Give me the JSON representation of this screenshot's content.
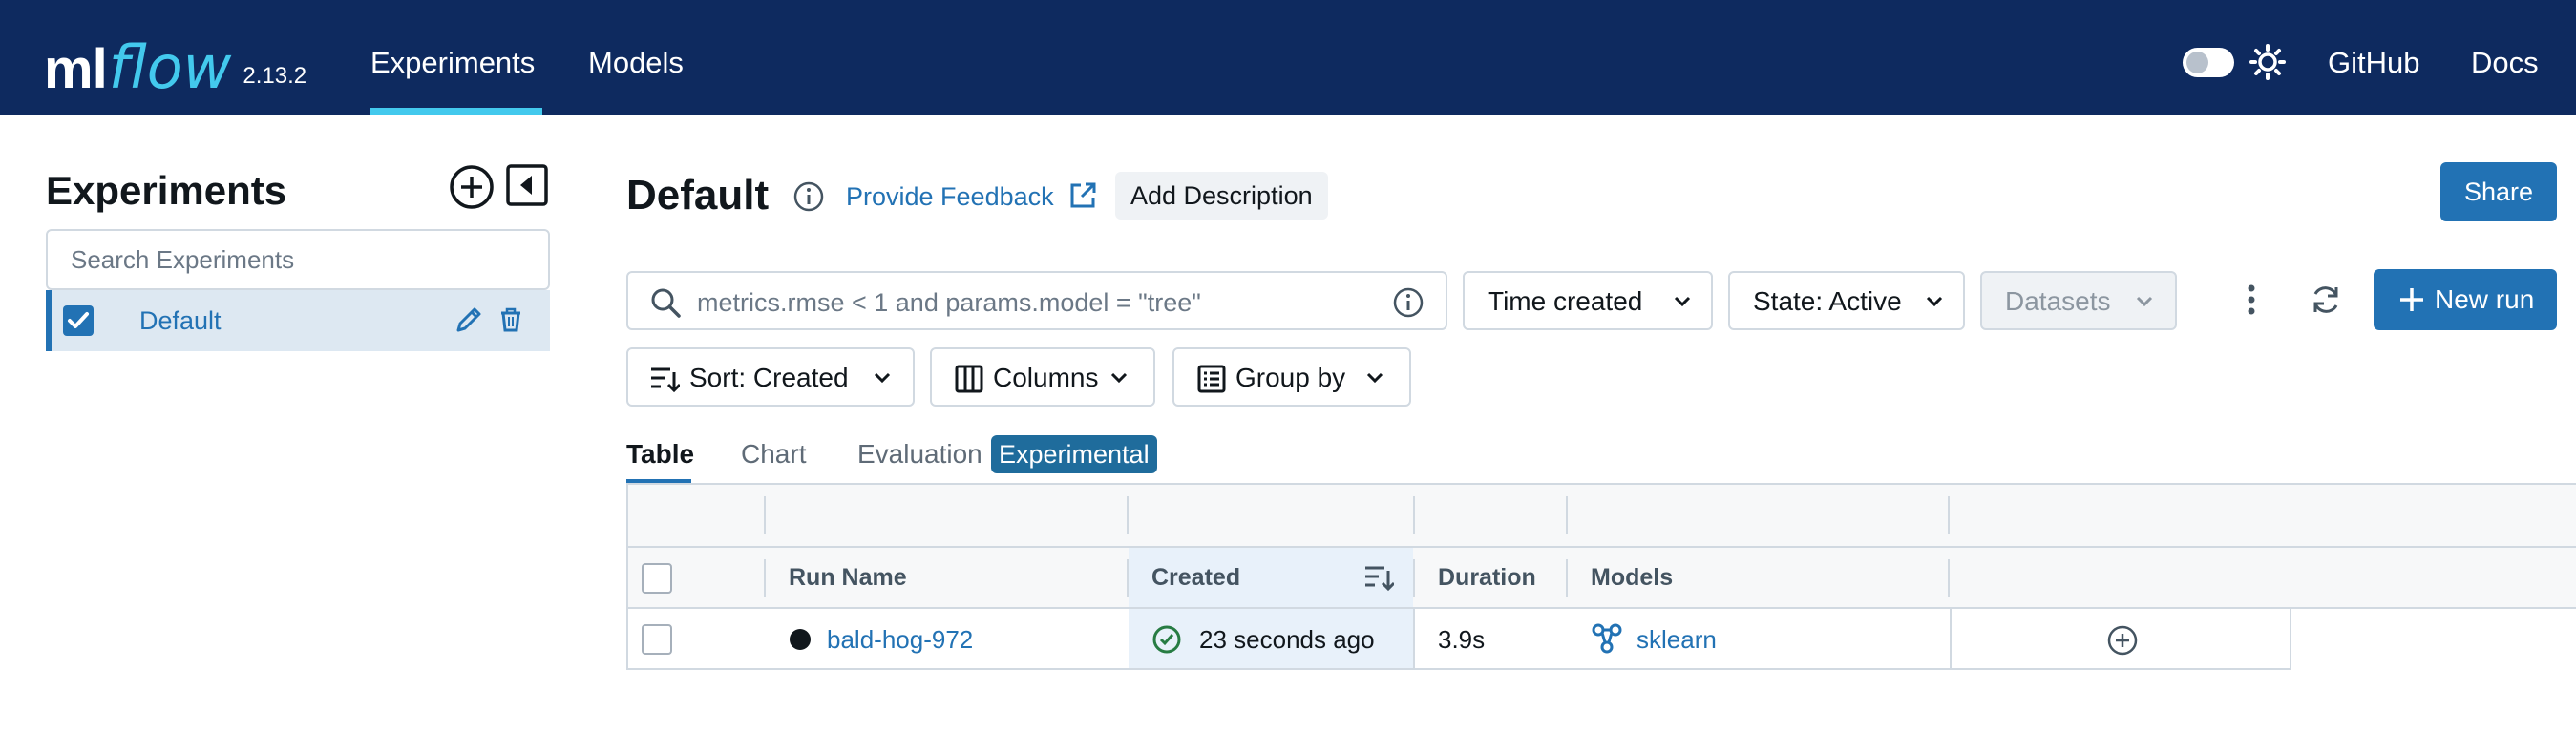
{
  "header": {
    "logo_main": "ml",
    "logo_accent": "flow",
    "version": "2.13.2",
    "nav": [
      {
        "label": "Experiments",
        "active": true
      },
      {
        "label": "Models",
        "active": false
      }
    ],
    "links": {
      "github": "GitHub",
      "docs": "Docs"
    },
    "theme_toggle_on": false
  },
  "sidebar": {
    "title": "Experiments",
    "search_placeholder": "Search Experiments",
    "experiments": [
      {
        "name": "Default",
        "selected": true
      }
    ]
  },
  "main": {
    "title": "Default",
    "feedback_label": "Provide Feedback",
    "add_description_label": "Add Description",
    "share_label": "Share",
    "search_placeholder": "metrics.rmse < 1 and params.model = \"tree\"",
    "filters": {
      "time_created": "Time created",
      "state": "State: Active",
      "datasets": "Datasets"
    },
    "new_run_label": "New run",
    "sort_label": "Sort: Created",
    "columns_label": "Columns",
    "group_by_label": "Group by",
    "tabs": [
      {
        "label": "Table",
        "active": true
      },
      {
        "label": "Chart",
        "active": false
      },
      {
        "label": "Evaluation",
        "active": false
      }
    ],
    "evaluation_badge": "Experimental"
  },
  "table": {
    "columns": [
      "Run Name",
      "Created",
      "Duration",
      "Models"
    ],
    "rows": [
      {
        "run_name": "bald-hog-972",
        "created": "23 seconds ago",
        "duration": "3.9s",
        "model": "sklearn"
      }
    ]
  },
  "colors": {
    "header_bg": "#0e2a5f",
    "accent": "#2272b4",
    "logo_accent": "#43c9ed",
    "success": "#277c43",
    "sorted_column_bg": "#e8f1fa"
  }
}
